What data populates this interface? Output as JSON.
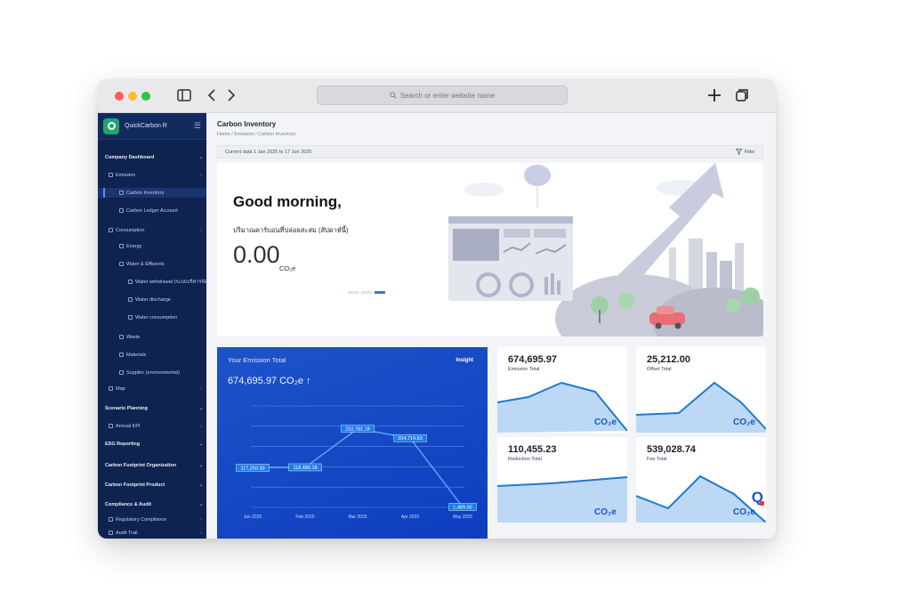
{
  "browser": {
    "address_placeholder": "Search or enter website name"
  },
  "sidebar": {
    "app_title": "QuickCarbon R",
    "items": [
      {
        "label": "Company Dashboard",
        "type": "section"
      },
      {
        "label": "Emission",
        "type": "group"
      },
      {
        "label": "Carbon Inventory",
        "type": "child",
        "active": true
      },
      {
        "label": "Carbon Ledger Account",
        "type": "child"
      },
      {
        "label": "Consumption",
        "type": "group"
      },
      {
        "label": "Energy",
        "type": "child"
      },
      {
        "label": "Water & Effluents",
        "type": "child"
      },
      {
        "label": "Water withdrawal (ระบบบริหารจัดการน้ำ)",
        "type": "grandchild"
      },
      {
        "label": "Water discharge",
        "type": "grandchild"
      },
      {
        "label": "Water consumption",
        "type": "grandchild"
      },
      {
        "label": "Waste",
        "type": "child"
      },
      {
        "label": "Materials",
        "type": "child"
      },
      {
        "label": "Supplier (environmental)",
        "type": "child"
      },
      {
        "label": "Map",
        "type": "group"
      },
      {
        "label": "Scenario Planning",
        "type": "section"
      },
      {
        "label": "Annual KPI",
        "type": "group"
      },
      {
        "label": "ESG Reporting",
        "type": "section"
      },
      {
        "label": "Carbon Footprint Organization",
        "type": "section"
      },
      {
        "label": "Carbon Footprint Product",
        "type": "section"
      },
      {
        "label": "Compliance & Audit",
        "type": "section"
      },
      {
        "label": "Regulatory Compliance",
        "type": "group"
      },
      {
        "label": "Audit Trail",
        "type": "group"
      }
    ]
  },
  "header": {
    "title": "Carbon Inventory",
    "breadcrumb": "Home / Emission / Carbon Inventory",
    "date_range": "Current data 1 Jan 2025 to 17 Jun 2025",
    "filter_label": "Filter"
  },
  "hero": {
    "greeting": "Good morning,",
    "subtitle": "ปริมาณคาร์บอนที่ปล่อยสะสม (สัปดาห์นี้)",
    "value": "0.00",
    "unit": "CO₂e"
  },
  "emission_panel": {
    "title": "Your Emission Total",
    "insight_label": "Insight",
    "total": "674,695.97 CO₂e ↑"
  },
  "cards": [
    {
      "value": "674,695.97",
      "label": "Emission Total",
      "unit": "CO₂e"
    },
    {
      "value": "25,212.00",
      "label": "Offset Total",
      "unit": "CO₂e"
    },
    {
      "value": "110,455.23",
      "label": "Reduction Total",
      "unit": "CO₂e"
    },
    {
      "value": "539,028.74",
      "label": "Fee Total",
      "unit": "CO₂e"
    }
  ],
  "chart_data": {
    "type": "line",
    "categories": [
      "Jan 2025",
      "Feb 2025",
      "Mar 2025",
      "Apr 2025",
      "May 2025"
    ],
    "series": [
      {
        "values": [
          117250.3,
          118480.18,
          232781.18,
          204714.83,
          1489.5
        ]
      }
    ],
    "data_labels": [
      "117,250.30",
      "118,480.18",
      "232,781.18",
      "204,714.83",
      "1,489.50"
    ],
    "ylim": [
      0,
      300000
    ],
    "grid": true,
    "line_color": "#5aa9ff"
  },
  "accent_color": "#1d55c0"
}
